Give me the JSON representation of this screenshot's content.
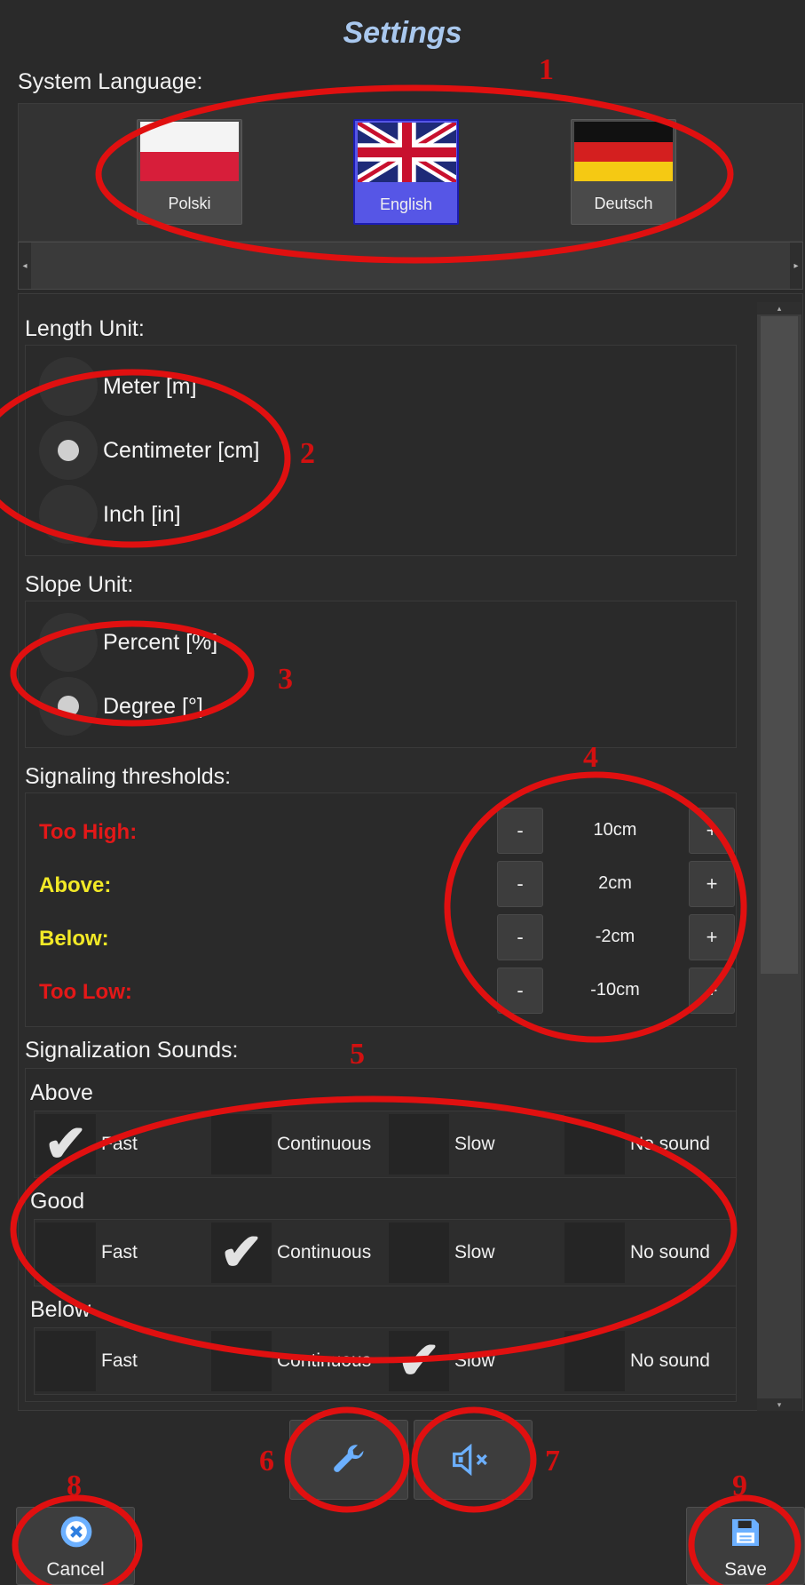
{
  "header": {
    "title": "Settings"
  },
  "language": {
    "label": "System Language:",
    "options": [
      {
        "name": "Polski",
        "flag": "poland-flag-icon",
        "selected": false
      },
      {
        "name": "English",
        "flag": "uk-flag-icon",
        "selected": true
      },
      {
        "name": "Deutsch",
        "flag": "germany-flag-icon",
        "selected": false
      }
    ]
  },
  "length_unit": {
    "label": "Length Unit:",
    "options": [
      "Meter [m]",
      "Centimeter [cm]",
      "Inch [in]"
    ],
    "selected": "Centimeter [cm]"
  },
  "slope_unit": {
    "label": "Slope Unit:",
    "options": [
      "Percent [%]",
      "Degree [°]"
    ],
    "selected": "Degree [°]"
  },
  "thresholds": {
    "label": "Signaling thresholds:",
    "minus": "-",
    "plus": "+",
    "rows": [
      {
        "name": "Too High:",
        "value": "10cm",
        "color": "#e31818"
      },
      {
        "name": "Above:",
        "value": "2cm",
        "color": "#f2e927"
      },
      {
        "name": "Below:",
        "value": "-2cm",
        "color": "#f2e927"
      },
      {
        "name": "Too Low:",
        "value": "-10cm",
        "color": "#e31818"
      }
    ]
  },
  "sounds": {
    "label": "Signalization Sounds:",
    "options": [
      "Fast",
      "Continuous",
      "Slow",
      "No sound"
    ],
    "groups": [
      {
        "name": "Above",
        "selected": "Fast"
      },
      {
        "name": "Good",
        "selected": "Continuous"
      },
      {
        "name": "Below",
        "selected": "Slow"
      }
    ]
  },
  "toolbar": {
    "tools_icon": "wrench-icon",
    "mute_icon": "speaker-mute-icon",
    "cancel_label": "Cancel",
    "save_label": "Save"
  },
  "annotations": [
    "1",
    "2",
    "3",
    "4",
    "5",
    "6",
    "7",
    "8",
    "9"
  ],
  "colors": {
    "accent": "#5656e6",
    "title": "#a9c8ee",
    "annotation": "#d21010",
    "icon": "#6cb0ff"
  }
}
